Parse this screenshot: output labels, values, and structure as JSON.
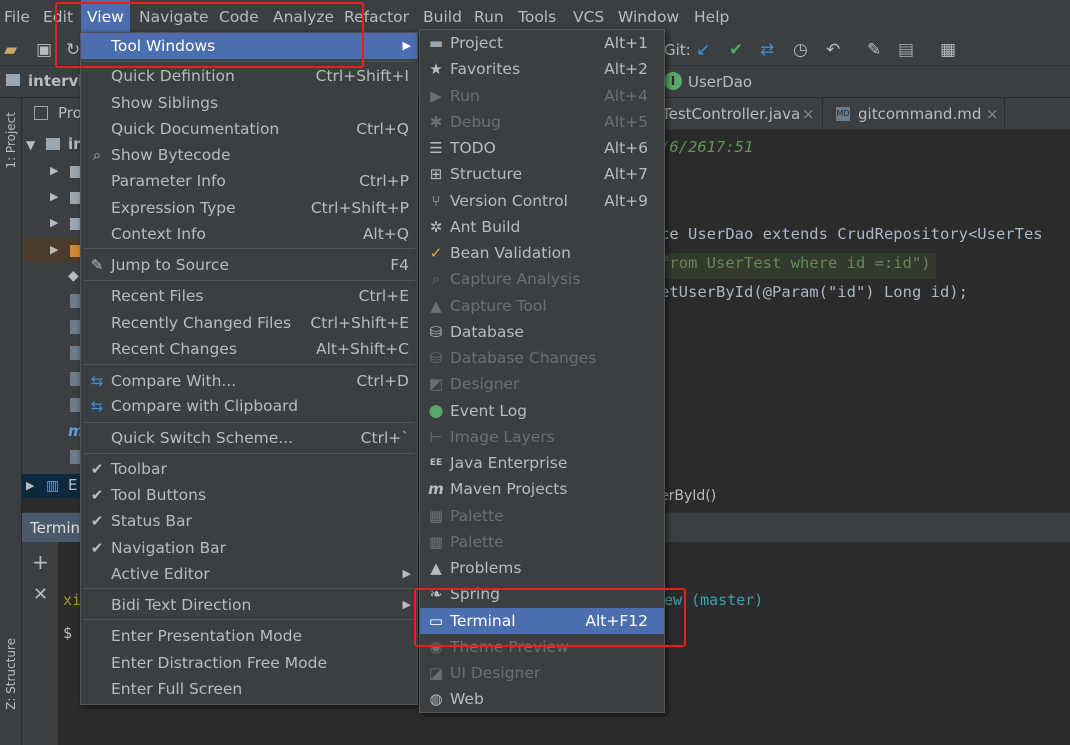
{
  "menubar": {
    "items": [
      "File",
      "Edit",
      "View",
      "Navigate",
      "Code",
      "Analyze",
      "Refactor",
      "Build",
      "Run",
      "Tools",
      "VCS",
      "Window",
      "Help"
    ]
  },
  "toolbar": {
    "git_label": "Git:"
  },
  "navbar": {
    "crumb": "intervi",
    "class_crumb": "UserDao"
  },
  "left_strip": {
    "project_tab": "1: Project",
    "structure_tab": "Z: Structure"
  },
  "project_panel": {
    "title": "Pro",
    "root": "in",
    "external": "E"
  },
  "editor": {
    "tabs": [
      "TestController.java",
      "gitcommand.md"
    ],
    "lines": [
      "/6/2617:51",
      "ce UserDao extends CrudRepository<UserTes",
      "from UserTest where id =:id\")",
      "etUserById(@Param(\"id\") Long id);"
    ],
    "breadcrumb": "erById()"
  },
  "terminal": {
    "title": "Termin",
    "prompt_user": "xi",
    "prompt_branch": "ew (master)",
    "prompt_symbol": "$"
  },
  "view_menu": {
    "items": [
      {
        "label": "Tool Windows",
        "shortcut": "",
        "icon": "",
        "submenu": true,
        "selected": true
      },
      {
        "label": "Quick Definition",
        "shortcut": "Ctrl+Shift+I",
        "icon": ""
      },
      {
        "label": "Show Siblings",
        "shortcut": "",
        "icon": ""
      },
      {
        "label": "Quick Documentation",
        "shortcut": "Ctrl+Q",
        "icon": ""
      },
      {
        "label": "Show Bytecode",
        "shortcut": "",
        "icon": "search-icon"
      },
      {
        "label": "Parameter Info",
        "shortcut": "Ctrl+P",
        "icon": ""
      },
      {
        "label": "Expression Type",
        "shortcut": "Ctrl+Shift+P",
        "icon": ""
      },
      {
        "label": "Context Info",
        "shortcut": "Alt+Q",
        "icon": ""
      },
      {
        "label": "Jump to Source",
        "shortcut": "F4",
        "icon": "pencil-icon"
      },
      {
        "label": "Recent Files",
        "shortcut": "Ctrl+E",
        "icon": ""
      },
      {
        "label": "Recently Changed Files",
        "shortcut": "Ctrl+Shift+E",
        "icon": ""
      },
      {
        "label": "Recent Changes",
        "shortcut": "Alt+Shift+C",
        "icon": ""
      },
      {
        "label": "Compare With...",
        "shortcut": "Ctrl+D",
        "icon": "compare-icon"
      },
      {
        "label": "Compare with Clipboard",
        "shortcut": "",
        "icon": "compare-clipboard-icon"
      },
      {
        "label": "Quick Switch Scheme...",
        "shortcut": "Ctrl+`",
        "icon": ""
      },
      {
        "label": "Toolbar",
        "shortcut": "",
        "icon": "check-icon"
      },
      {
        "label": "Tool Buttons",
        "shortcut": "",
        "icon": "check-icon"
      },
      {
        "label": "Status Bar",
        "shortcut": "",
        "icon": "check-icon"
      },
      {
        "label": "Navigation Bar",
        "shortcut": "",
        "icon": "check-icon"
      },
      {
        "label": "Active Editor",
        "shortcut": "",
        "icon": "",
        "submenu": true
      },
      {
        "label": "Bidi Text Direction",
        "shortcut": "",
        "icon": "",
        "submenu": true
      },
      {
        "label": "Enter Presentation Mode",
        "shortcut": "",
        "icon": ""
      },
      {
        "label": "Enter Distraction Free Mode",
        "shortcut": "",
        "icon": ""
      },
      {
        "label": "Enter Full Screen",
        "shortcut": "",
        "icon": ""
      }
    ]
  },
  "tool_windows_menu": {
    "items": [
      {
        "label": "Project",
        "shortcut": "Alt+1",
        "icon": "folder-icon",
        "enabled": true
      },
      {
        "label": "Favorites",
        "shortcut": "Alt+2",
        "icon": "star-icon",
        "enabled": true
      },
      {
        "label": "Run",
        "shortcut": "Alt+4",
        "icon": "play-icon",
        "enabled": false
      },
      {
        "label": "Debug",
        "shortcut": "Alt+5",
        "icon": "bug-icon",
        "enabled": false
      },
      {
        "label": "TODO",
        "shortcut": "Alt+6",
        "icon": "list-icon",
        "enabled": true
      },
      {
        "label": "Structure",
        "shortcut": "Alt+7",
        "icon": "structure-icon",
        "enabled": true
      },
      {
        "label": "Version Control",
        "shortcut": "Alt+9",
        "icon": "vcs-icon",
        "enabled": true
      },
      {
        "label": "Ant Build",
        "shortcut": "",
        "icon": "ant-icon",
        "enabled": true
      },
      {
        "label": "Bean Validation",
        "shortcut": "",
        "icon": "bean-icon",
        "enabled": true
      },
      {
        "label": "Capture Analysis",
        "shortcut": "",
        "icon": "search-icon",
        "enabled": false
      },
      {
        "label": "Capture Tool",
        "shortcut": "",
        "icon": "triangle-icon",
        "enabled": false
      },
      {
        "label": "Database",
        "shortcut": "",
        "icon": "database-icon",
        "enabled": true
      },
      {
        "label": "Database Changes",
        "shortcut": "",
        "icon": "database-changes-icon",
        "enabled": false
      },
      {
        "label": "Designer",
        "shortcut": "",
        "icon": "designer-icon",
        "enabled": false
      },
      {
        "label": "Event Log",
        "shortcut": "",
        "icon": "event-log-icon",
        "enabled": true
      },
      {
        "label": "Image Layers",
        "shortcut": "",
        "icon": "layers-icon",
        "enabled": false
      },
      {
        "label": "Java Enterprise",
        "shortcut": "",
        "icon": "ee-icon",
        "enabled": true
      },
      {
        "label": "Maven Projects",
        "shortcut": "",
        "icon": "maven-icon",
        "enabled": true
      },
      {
        "label": "Palette",
        "shortcut": "",
        "icon": "palette-icon",
        "enabled": false
      },
      {
        "label": "Palette",
        "shortcut": "",
        "icon": "palette-icon",
        "enabled": false
      },
      {
        "label": "Problems",
        "shortcut": "",
        "icon": "warning-icon",
        "enabled": true
      },
      {
        "label": "Spring",
        "shortcut": "",
        "icon": "spring-icon",
        "enabled": true
      },
      {
        "label": "Terminal",
        "shortcut": "Alt+F12",
        "icon": "terminal-icon",
        "enabled": true,
        "selected": true
      },
      {
        "label": "Theme Preview",
        "shortcut": "",
        "icon": "eye-icon",
        "enabled": false
      },
      {
        "label": "UI Designer",
        "shortcut": "",
        "icon": "ui-designer-icon",
        "enabled": false
      },
      {
        "label": "Web",
        "shortcut": "",
        "icon": "globe-icon",
        "enabled": true
      }
    ]
  },
  "colors": {
    "accent": "#4b6eaf",
    "menu_bg": "#3c3f41",
    "highlight_box": "#e8201c"
  }
}
